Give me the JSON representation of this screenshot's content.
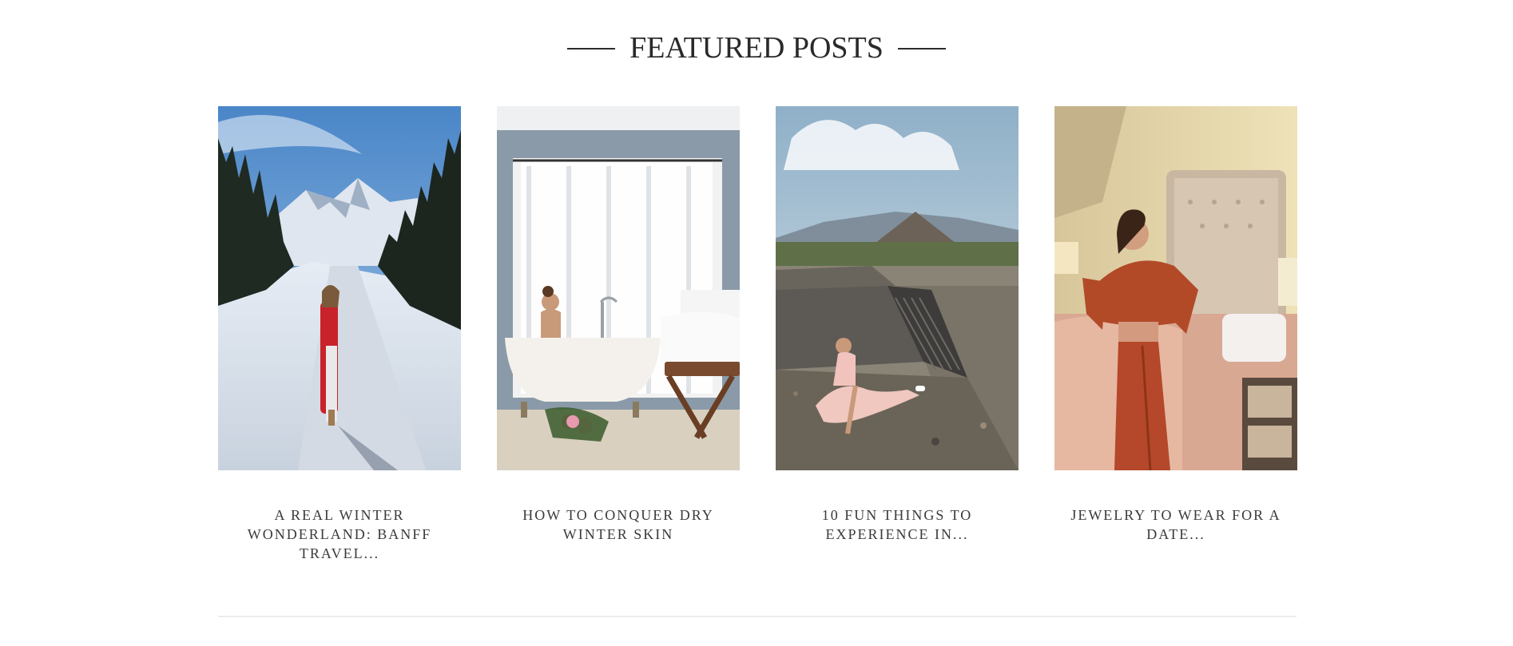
{
  "section": {
    "title": "FEATURED POSTS"
  },
  "posts": [
    {
      "title": "A REAL WINTER WONDERLAND: BANFF TRAVEL...",
      "image_icon": "winter-road-photo"
    },
    {
      "title": "HOW TO CONQUER DRY WINTER SKIN",
      "image_icon": "bathtub-photo"
    },
    {
      "title": "10 FUN THINGS TO EXPERIENCE IN...",
      "image_icon": "pyramid-photo"
    },
    {
      "title": "JEWELRY TO WEAR FOR A DATE...",
      "image_icon": "bedroom-portrait-photo"
    }
  ],
  "colors": {
    "text": "#2b2b2b",
    "divider": "#ececec",
    "background": "#ffffff"
  }
}
